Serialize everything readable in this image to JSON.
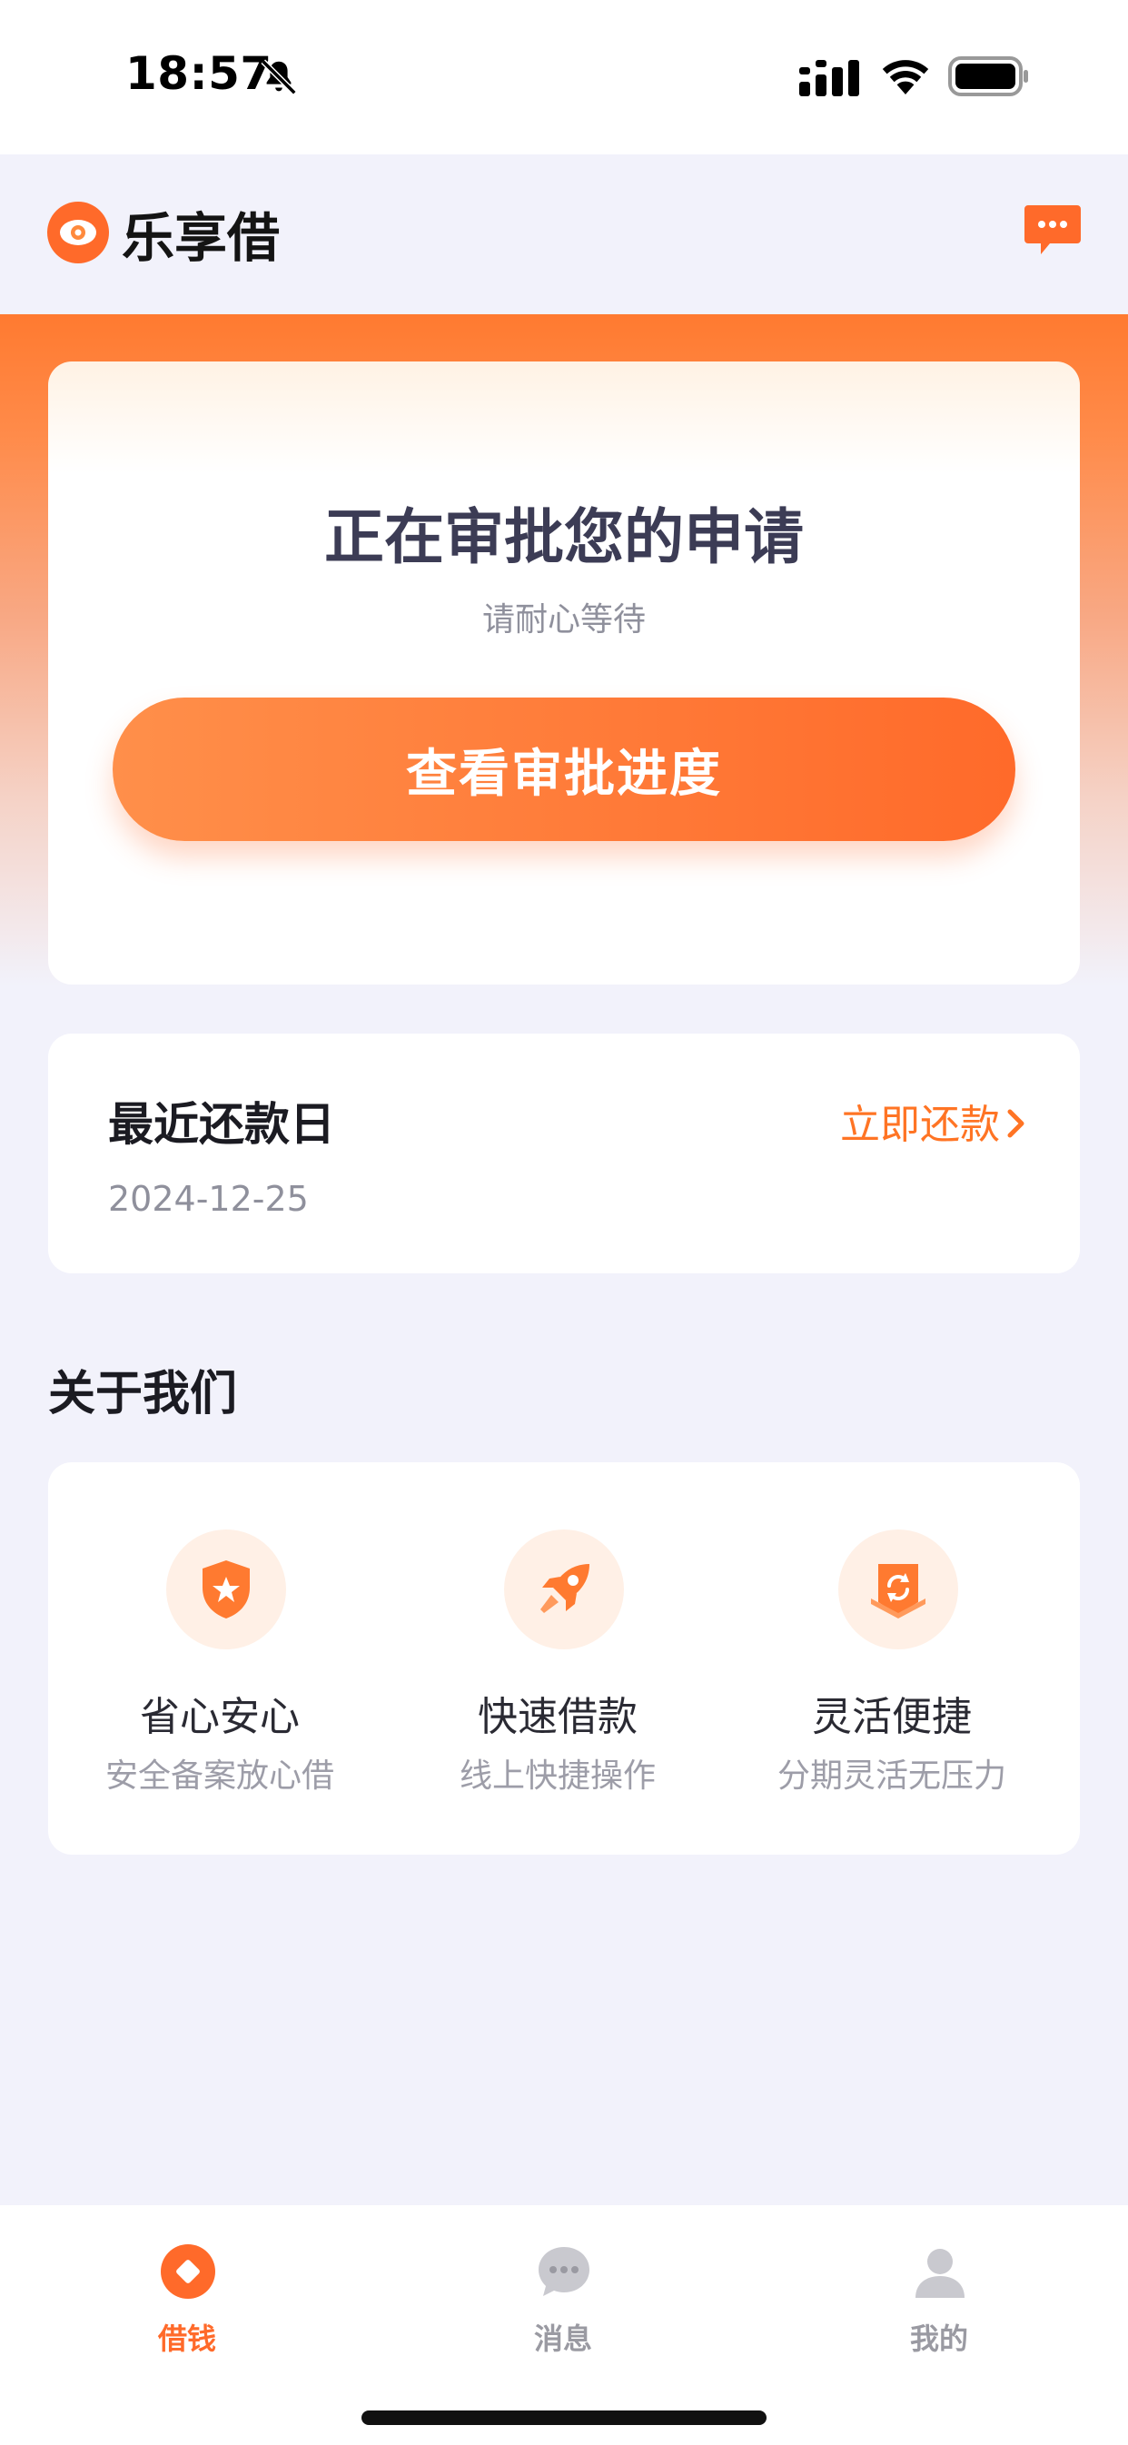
{
  "status_bar": {
    "time": "18:57"
  },
  "app": {
    "name": "乐享借"
  },
  "approval": {
    "title": "正在审批您的申请",
    "subtitle": "请耐心等待",
    "button_label": "查看审批进度"
  },
  "repayment": {
    "label": "最近还款日",
    "date": "2024-12-25",
    "action_label": "立即还款"
  },
  "about": {
    "title": "关于我们",
    "features": [
      {
        "title": "省心安心",
        "subtitle": "安全备案放心借",
        "icon": "shield-star-icon"
      },
      {
        "title": "快速借款",
        "subtitle": "线上快捷操作",
        "icon": "rocket-icon"
      },
      {
        "title": "灵活便捷",
        "subtitle": "分期灵活无压力",
        "icon": "refresh-badge-icon"
      }
    ]
  },
  "tabs": [
    {
      "label": "借钱",
      "icon": "borrow-icon",
      "active": true
    },
    {
      "label": "消息",
      "icon": "message-icon",
      "active": false
    },
    {
      "label": "我的",
      "icon": "profile-icon",
      "active": false
    }
  ],
  "colors": {
    "accent": "#ff7424",
    "tab_active": "#ff6a2a",
    "tab_inactive": "#9a9aa2",
    "background": "#f2f2fb"
  }
}
